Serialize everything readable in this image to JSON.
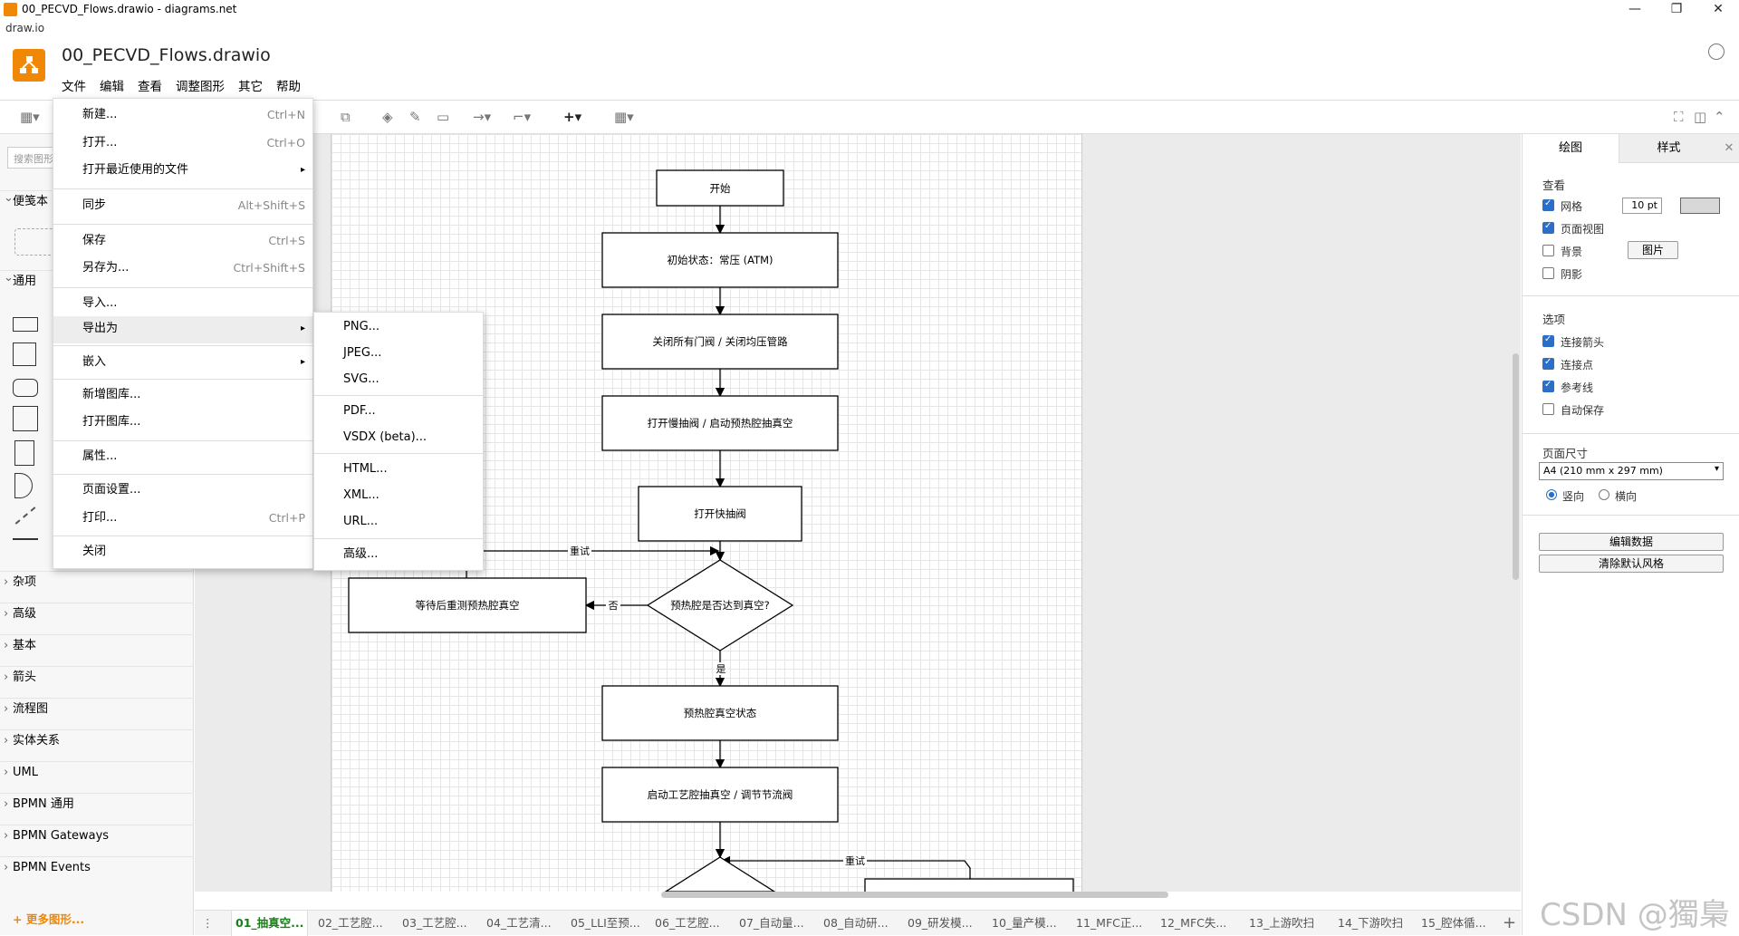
{
  "window": {
    "title": "00_PECVD_Flows.drawio - diagrams.net",
    "app_name": "draw.io"
  },
  "doc": {
    "name": "00_PECVD_Flows.drawio"
  },
  "menubar": [
    "文件",
    "编辑",
    "查看",
    "调整图形",
    "其它",
    "帮助"
  ],
  "sidebar": {
    "search_placeholder": "搜索图形",
    "sections": [
      "便笺本",
      "通用",
      "杂项",
      "高级",
      "基本",
      "箭头",
      "流程图",
      "实体关系",
      "UML",
      "BPMN 通用",
      "BPMN Gateways",
      "BPMN Events"
    ],
    "more_shapes": "+ 更多图形..."
  },
  "file_menu": {
    "items": [
      {
        "label": "新建...",
        "shortcut": "Ctrl+N"
      },
      {
        "label": "打开...",
        "shortcut": "Ctrl+O"
      },
      {
        "label": "打开最近使用的文件",
        "shortcut": ""
      },
      {
        "label": "同步",
        "shortcut": "Alt+Shift+S"
      },
      {
        "label": "保存",
        "shortcut": "Ctrl+S"
      },
      {
        "label": "另存为...",
        "shortcut": "Ctrl+Shift+S"
      },
      {
        "label": "导入...",
        "shortcut": ""
      },
      {
        "label": "导出为",
        "shortcut": ""
      },
      {
        "label": "嵌入",
        "shortcut": ""
      },
      {
        "label": "新增图库...",
        "shortcut": ""
      },
      {
        "label": "打开图库...",
        "shortcut": ""
      },
      {
        "label": "属性...",
        "shortcut": ""
      },
      {
        "label": "页面设置...",
        "shortcut": ""
      },
      {
        "label": "打印...",
        "shortcut": "Ctrl+P"
      },
      {
        "label": "关闭",
        "shortcut": ""
      }
    ]
  },
  "export_menu": {
    "items": [
      "PNG...",
      "JPEG...",
      "SVG...",
      "PDF...",
      "VSDX (beta)...",
      "HTML...",
      "XML...",
      "URL...",
      "高级..."
    ]
  },
  "diagram": {
    "nodes": {
      "start": "开始",
      "s1": "初始状态：常压 (ATM)",
      "s2": "关闭所有门阀 / 关闭均压管路",
      "s3": "打开慢抽阀 / 启动预热腔抽真空",
      "s4": "打开快抽阀",
      "decision": "预热腔是否达到真空?",
      "wait": "等待后重测预热腔真空",
      "s5": "预热腔真空状态",
      "s6": "启动工艺腔抽真空 / 调节节流阀"
    },
    "edge_labels": {
      "retry": "重试",
      "no": "否",
      "yes": "是",
      "retry2": "重试"
    }
  },
  "right_panel": {
    "tabs": [
      "绘图",
      "样式"
    ],
    "view_heading": "查看",
    "grid_label": "网格",
    "grid_size": "10 pt",
    "page_view_label": "页面视图",
    "background_label": "背景",
    "image_button": "图片",
    "shadow_label": "阴影",
    "options_heading": "选项",
    "connection_arrows": "连接箭头",
    "connection_points": "连接点",
    "guides": "参考线",
    "autosave": "自动保存",
    "page_size_heading": "页面尺寸",
    "page_size_value": "A4 (210 mm x 297 mm)",
    "portrait": "竖向",
    "landscape": "横向",
    "edit_data": "编辑数据",
    "clear_style": "清除默认风格"
  },
  "page_tabs": [
    "01_抽真空...",
    "02_工艺腔...",
    "03_工艺腔...",
    "04_工艺清...",
    "05_LLI至预...",
    "06_工艺腔...",
    "07_自动量...",
    "08_自动研...",
    "09_研发模...",
    "10_量产模...",
    "11_MFC正...",
    "12_MFC失...",
    "13_上游吹扫",
    "14_下游吹扫",
    "15_腔体循..."
  ],
  "watermark": "CSDN @獨梟",
  "colors": {
    "accent": "#f08705",
    "active_tab": "#1a7f1a",
    "checkbox": "#2b6fc8"
  }
}
